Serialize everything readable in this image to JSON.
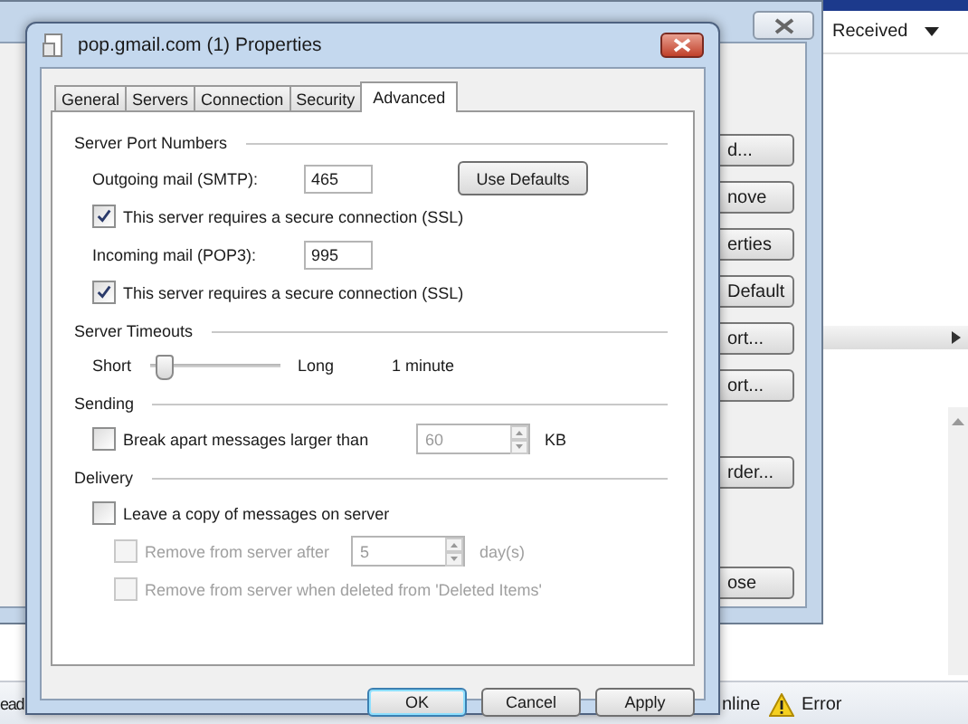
{
  "app": {
    "column_header": "Received",
    "status_left": "ead",
    "status_connection": "nline",
    "status_error": "Error"
  },
  "background_dialog": {
    "buttons": [
      "d...",
      "nove",
      "erties",
      "Default",
      "ort...",
      "ort...",
      "rder...",
      "ose"
    ]
  },
  "dialog": {
    "title": "pop.gmail.com (1) Properties",
    "tabs": [
      {
        "label": "General",
        "selected": false
      },
      {
        "label": "Servers",
        "selected": false
      },
      {
        "label": "Connection",
        "selected": false
      },
      {
        "label": "Security",
        "selected": false
      },
      {
        "label": "Advanced",
        "selected": true
      }
    ],
    "sections": [
      {
        "title": "Server Port Numbers",
        "rows": [
          {
            "kind": "port",
            "label": "Outgoing mail (SMTP):",
            "value": "465",
            "button": "Use Defaults"
          },
          {
            "kind": "checkbox",
            "label": "This server requires a secure connection (SSL)",
            "checked": true,
            "disabled": false
          },
          {
            "kind": "port",
            "label": "Incoming mail (POP3):",
            "value": "995"
          },
          {
            "kind": "checkbox",
            "label": "This server requires a secure connection (SSL)",
            "checked": true,
            "disabled": false
          }
        ]
      },
      {
        "title": "Server Timeouts",
        "rows": [
          {
            "kind": "slider",
            "min_label": "Short",
            "max_label": "Long",
            "level": 0.1,
            "reading": "1 minute"
          }
        ]
      },
      {
        "title": "Sending",
        "rows": [
          {
            "kind": "checkbox_spin",
            "label": "Break apart messages larger than",
            "checked": false,
            "disabled": false,
            "value": "60",
            "field_disabled": true,
            "unit": "KB"
          }
        ]
      },
      {
        "title": "Delivery",
        "rows": [
          {
            "kind": "checkbox",
            "label": "Leave a copy of messages on server",
            "checked": false,
            "disabled": false,
            "children": [
              {
                "kind": "checkbox_spin",
                "label": "Remove from server after",
                "checked": false,
                "disabled": true,
                "value": "5",
                "field_disabled": true,
                "unit": "day(s)"
              },
              {
                "kind": "checkbox",
                "label": "Remove from server when deleted from 'Deleted Items'",
                "checked": false,
                "disabled": true
              }
            ]
          }
        ]
      }
    ],
    "buttons": [
      {
        "label": "OK",
        "default": true
      },
      {
        "label": "Cancel",
        "default": false
      },
      {
        "label": "Apply",
        "default": false
      }
    ]
  }
}
